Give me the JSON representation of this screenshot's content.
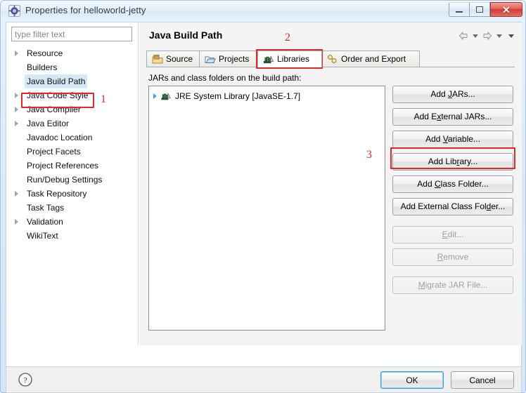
{
  "window": {
    "title": "Properties for helloworld-jetty",
    "icon": "gear-icon",
    "controls": {
      "minimize": "—",
      "maximize": "□",
      "close": "✕"
    }
  },
  "sidebar": {
    "filter": {
      "placeholder": "type filter text",
      "value": ""
    },
    "items": [
      {
        "label": "Resource",
        "expandable": true,
        "selected": false
      },
      {
        "label": "Builders",
        "expandable": false,
        "selected": false
      },
      {
        "label": "Java Build Path",
        "expandable": false,
        "selected": true
      },
      {
        "label": "Java Code Style",
        "expandable": true,
        "selected": false
      },
      {
        "label": "Java Compiler",
        "expandable": true,
        "selected": false
      },
      {
        "label": "Java Editor",
        "expandable": true,
        "selected": false
      },
      {
        "label": "Javadoc Location",
        "expandable": false,
        "selected": false
      },
      {
        "label": "Project Facets",
        "expandable": false,
        "selected": false
      },
      {
        "label": "Project References",
        "expandable": false,
        "selected": false
      },
      {
        "label": "Run/Debug Settings",
        "expandable": false,
        "selected": false
      },
      {
        "label": "Task Repository",
        "expandable": true,
        "selected": false
      },
      {
        "label": "Task Tags",
        "expandable": false,
        "selected": false
      },
      {
        "label": "Validation",
        "expandable": true,
        "selected": false
      },
      {
        "label": "WikiText",
        "expandable": false,
        "selected": false
      }
    ]
  },
  "main": {
    "page_title": "Java Build Path",
    "nav": {
      "back": "back-arrow-icon",
      "forward": "forward-arrow-icon",
      "menu": "chevron-down-icon"
    },
    "tabs": [
      {
        "label": "Source",
        "icon": "source-folder-icon",
        "active": false
      },
      {
        "label": "Projects",
        "icon": "open-folder-icon",
        "active": false
      },
      {
        "label": "Libraries",
        "icon": "library-books-icon",
        "active": true
      },
      {
        "label": "Order and Export",
        "icon": "order-export-icon",
        "active": false
      }
    ],
    "list_label": "JARs and class folders on the build path:",
    "entries": [
      {
        "label": "JRE System Library [JavaSE-1.7]",
        "icon": "library-books-icon",
        "expandable": true
      }
    ],
    "buttons": [
      {
        "label": "Add JARs...",
        "mnemonic": "J",
        "enabled": true,
        "highlighted": false
      },
      {
        "label": "Add External JARs...",
        "mnemonic": "x",
        "enabled": true,
        "highlighted": false
      },
      {
        "label": "Add Variable...",
        "mnemonic": "V",
        "enabled": true,
        "highlighted": false
      },
      {
        "label": "Add Library...",
        "mnemonic": "r",
        "enabled": true,
        "highlighted": true
      },
      {
        "label": "Add Class Folder...",
        "mnemonic": "C",
        "enabled": true,
        "highlighted": false
      },
      {
        "label": "Add External Class Folder...",
        "mnemonic": "d",
        "enabled": true,
        "highlighted": false
      },
      {
        "label": "Edit...",
        "mnemonic": "E",
        "enabled": false,
        "highlighted": false
      },
      {
        "label": "Remove",
        "mnemonic": "R",
        "enabled": false,
        "highlighted": false
      },
      {
        "label": "Migrate JAR File...",
        "mnemonic": "M",
        "enabled": false,
        "highlighted": false
      }
    ]
  },
  "footer": {
    "help": "help-icon",
    "ok_label": "OK",
    "cancel_label": "Cancel"
  },
  "annotations": [
    {
      "number": "1",
      "target": "Java Build Path"
    },
    {
      "number": "2",
      "target": "Libraries"
    },
    {
      "number": "3",
      "target": "Add Library..."
    }
  ],
  "colors": {
    "annotation_red": "#e02a2a",
    "selection_blue": "#d3e8f8",
    "close_red": "#cf3a33",
    "focus_blue": "#3c9cd4"
  }
}
